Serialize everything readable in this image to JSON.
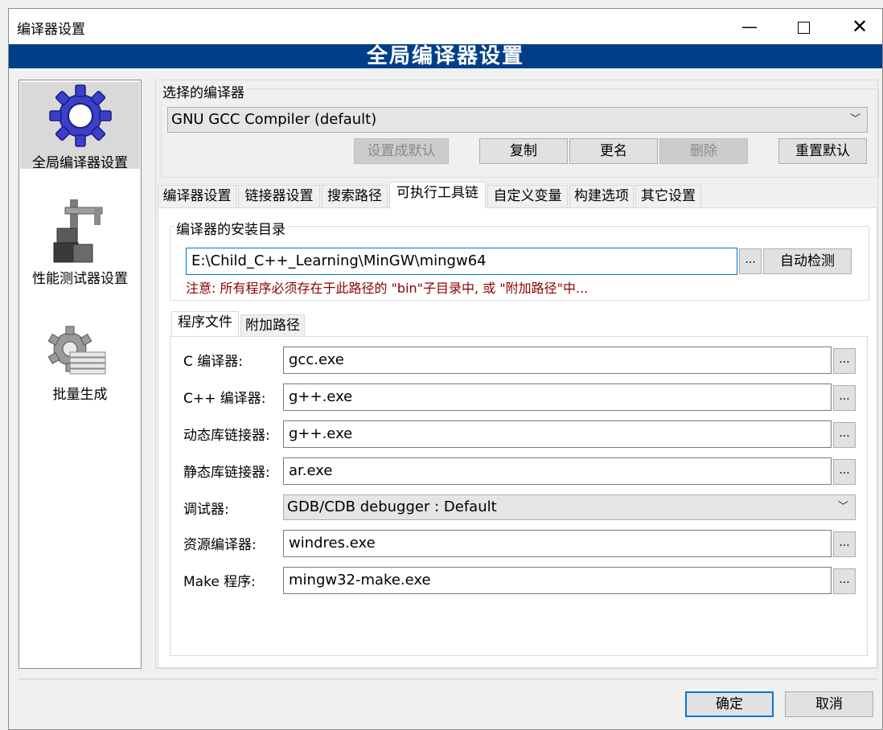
{
  "window": {
    "title": "编译器设置",
    "banner": "全局编译器设置"
  },
  "sidebar": {
    "items": [
      {
        "label": "全局编译器设置",
        "icon": "gear-icon"
      },
      {
        "label": "性能测试器设置",
        "icon": "caliper-icon"
      },
      {
        "label": "批量生成",
        "icon": "batch-build-icon"
      }
    ]
  },
  "compiler_select": {
    "label": "选择的编译器",
    "value": "GNU GCC Compiler (default)",
    "buttons": {
      "set_default": "设置成默认",
      "copy": "复制",
      "rename": "更名",
      "delete": "删除",
      "reset": "重置默认"
    }
  },
  "tabs": [
    "编译器设置",
    "链接器设置",
    "搜索路径",
    "可执行工具链",
    "自定义变量",
    "构建选项",
    "其它设置"
  ],
  "install_dir": {
    "label": "编译器的安装目录",
    "value": "E:\\Child_C++_Learning\\MinGW\\mingw64",
    "browse": "...",
    "autodetect": "自动检测",
    "note": "注意: 所有程序必须存在于此路径的 \"bin\"子目录中, 或 \"附加路径\"中..."
  },
  "subtabs": [
    "程序文件",
    "附加路径"
  ],
  "programs": {
    "c_compiler": {
      "label": "C 编译器:",
      "value": "gcc.exe"
    },
    "cpp_compiler": {
      "label": "C++ 编译器:",
      "value": "g++.exe"
    },
    "dyn_linker": {
      "label": "动态库链接器:",
      "value": "g++.exe"
    },
    "static_linker": {
      "label": "静态库链接器:",
      "value": "ar.exe"
    },
    "debugger": {
      "label": "调试器:",
      "value": "GDB/CDB debugger : Default"
    },
    "resource_compiler": {
      "label": "资源编译器:",
      "value": "windres.exe"
    },
    "make": {
      "label": "Make 程序:",
      "value": "mingw32-make.exe"
    },
    "browse": "..."
  },
  "footer": {
    "ok": "确定",
    "cancel": "取消"
  },
  "colors": {
    "banner": "#003f87",
    "focus": "#0078d7",
    "warning": "#8b0000"
  }
}
